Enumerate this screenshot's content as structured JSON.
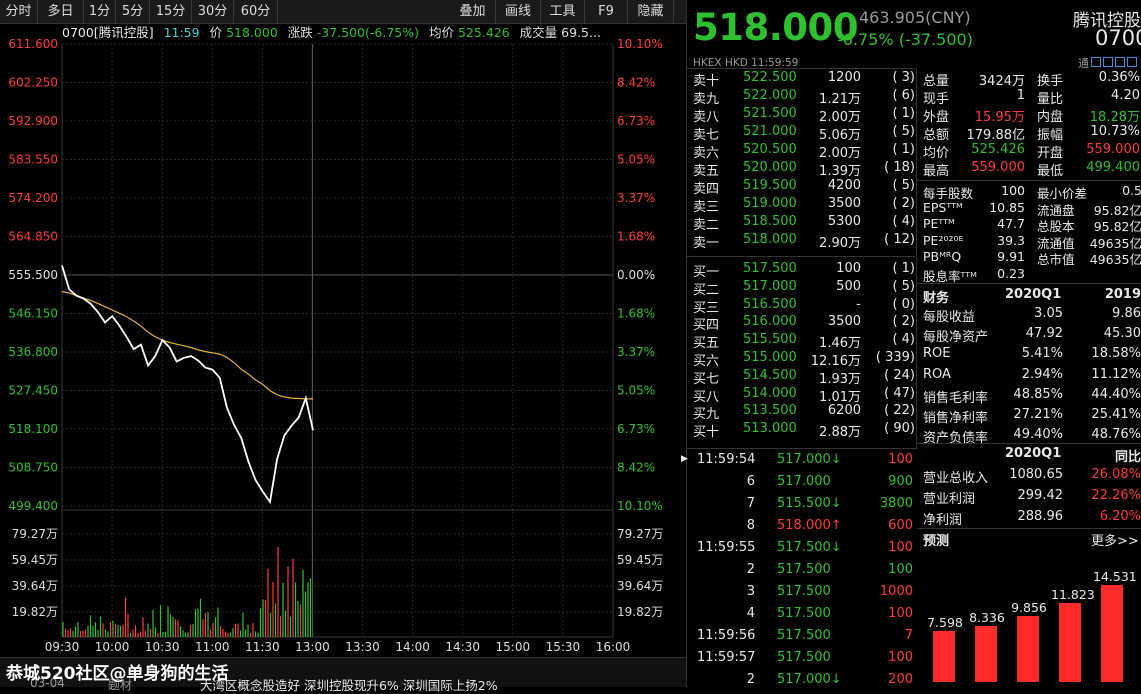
{
  "toolbar": {
    "tabs": [
      "分时",
      "多日",
      "1分",
      "5分",
      "15分",
      "30分",
      "60分"
    ],
    "right": [
      "叠加",
      "画线",
      "工具",
      "F9",
      "隐藏"
    ]
  },
  "info_bar": {
    "code": "0700[腾讯控股]",
    "time": "11:59",
    "price_label": "价",
    "price": "518.000",
    "change_label": "涨跌",
    "change": "-37.500(-6.75%)",
    "avg_label": "均价",
    "avg": "525.426",
    "vol_label": "成交量",
    "vol": "69.5..."
  },
  "price_axis": {
    "left": [
      "611.600",
      "602.250",
      "592.900",
      "583.550",
      "574.200",
      "564.850",
      "555.500",
      "546.150",
      "536.800",
      "527.450",
      "518.100",
      "508.750",
      "499.400"
    ],
    "right": [
      "10.10%",
      "8.42%",
      "6.73%",
      "5.05%",
      "3.37%",
      "1.68%",
      "0.00%",
      "1.68%",
      "3.37%",
      "5.05%",
      "6.73%",
      "8.42%",
      "10.10%"
    ]
  },
  "vol_axis": [
    "79.27万",
    "59.45万",
    "39.64万",
    "19.82万"
  ],
  "time_axis": [
    "09:30",
    "10:00",
    "10:30",
    "11:00",
    "11:30",
    "13:00",
    "13:30",
    "14:00",
    "14:30",
    "15:00",
    "15:30",
    "16:00"
  ],
  "chart_data": {
    "type": "line",
    "series": [
      {
        "values": [
          557.8,
          552,
          550.5,
          549.8,
          548.5,
          546.5,
          544,
          545.5,
          543.2,
          540.5,
          537.5,
          538.6,
          533.5,
          535.8,
          539.7,
          537.9,
          534.5,
          535.4,
          535.8,
          534.7,
          533,
          532.5,
          530.5,
          523.3,
          519.1,
          515.9,
          510.1,
          505.7,
          502.9,
          500.4,
          510.8,
          516.5,
          518.9,
          520.9,
          525.6,
          517.8
        ]
      },
      {
        "values": [
          551.5,
          551.1,
          550.5,
          549.9,
          549.3,
          548.6,
          547.8,
          547,
          546.2,
          545.4,
          544.3,
          543.1,
          541.6,
          540.5,
          539.7,
          539.1,
          538.7,
          538.3,
          537.9,
          537.3,
          536.9,
          536.6,
          536.3,
          535.5,
          534.2,
          532.6,
          531.4,
          530,
          528.9,
          527.4,
          526.4,
          525.9,
          525.6,
          525.5,
          525.4,
          525.4
        ]
      }
    ]
  },
  "watermark": "恭城520社区@单身狗的生活",
  "news": {
    "date": "03-04",
    "cat": "题材",
    "text": "大湾区概念股造好 深圳控股现升6% 深圳国际上扬2%"
  },
  "quote": {
    "price": "518.000",
    "change_pct": "-6.75%",
    "change": "(-37.500)",
    "cny": "463.905(CNY)",
    "name": "腾讯控股",
    "code": "0700",
    "market": "HKEX  HKD  11:59:59",
    "icons": "通"
  },
  "asks": [
    {
      "l": "卖十",
      "p": "522.500",
      "v": "1200",
      "n": "3"
    },
    {
      "l": "卖九",
      "p": "522.000",
      "v": "1.21万",
      "n": "6"
    },
    {
      "l": "卖八",
      "p": "521.500",
      "v": "2.00万",
      "n": "1"
    },
    {
      "l": "卖七",
      "p": "521.000",
      "v": "5.06万",
      "n": "5"
    },
    {
      "l": "卖六",
      "p": "520.500",
      "v": "2.00万",
      "n": "1"
    },
    {
      "l": "卖五",
      "p": "520.000",
      "v": "1.39万",
      "n": "18"
    },
    {
      "l": "卖四",
      "p": "519.500",
      "v": "4200",
      "n": "5"
    },
    {
      "l": "卖三",
      "p": "519.000",
      "v": "3500",
      "n": "2"
    },
    {
      "l": "卖二",
      "p": "518.500",
      "v": "5300",
      "n": "4"
    },
    {
      "l": "卖一",
      "p": "518.000",
      "v": "2.90万",
      "n": "12"
    }
  ],
  "bids": [
    {
      "l": "买一",
      "p": "517.500",
      "v": "100",
      "n": "1"
    },
    {
      "l": "买二",
      "p": "517.000",
      "v": "500",
      "n": "5"
    },
    {
      "l": "买三",
      "p": "516.500",
      "v": "-",
      "n": "0"
    },
    {
      "l": "买四",
      "p": "516.000",
      "v": "3500",
      "n": "2"
    },
    {
      "l": "买五",
      "p": "515.500",
      "v": "1.46万",
      "n": "4"
    },
    {
      "l": "买六",
      "p": "515.000",
      "v": "12.16万",
      "n": "339"
    },
    {
      "l": "买七",
      "p": "514.500",
      "v": "1.93万",
      "n": "24"
    },
    {
      "l": "买八",
      "p": "514.000",
      "v": "1.01万",
      "n": "47"
    },
    {
      "l": "买九",
      "p": "513.500",
      "v": "6200",
      "n": "22"
    },
    {
      "l": "买十",
      "p": "513.000",
      "v": "2.88万",
      "n": "90"
    }
  ],
  "stats": [
    {
      "k": "总量",
      "v": "3424万",
      "k2": "换手",
      "v2": "0.36%"
    },
    {
      "k": "现手",
      "v": "1",
      "k2": "量比",
      "v2": "4.20"
    },
    {
      "k": "外盘",
      "v": "15.95万",
      "k2": "内盘",
      "v2": "18.28万"
    },
    {
      "k": "总额",
      "v": "179.88亿",
      "k2": "振幅",
      "v2": "10.73%"
    },
    {
      "k": "均价",
      "v": "525.426",
      "k2": "开盘",
      "v2": "559.000"
    },
    {
      "k": "最高",
      "v": "559.000",
      "k2": "最低",
      "v2": "499.400"
    }
  ],
  "stats2": [
    {
      "k": "每手股数",
      "v": "100",
      "k2": "最小价差",
      "v2": "0.5"
    },
    {
      "k": "EPSᵀᵀᴹ",
      "v": "10.85",
      "k2": "流通盘",
      "v2": "95.82亿"
    },
    {
      "k": "PEᵀᵀᴹ",
      "v": "47.7",
      "k2": "总股本",
      "v2": "95.82亿"
    },
    {
      "k": "PE²⁰²⁰ᴱ",
      "v": "39.3",
      "k2": "流通值",
      "v2": "49635亿"
    },
    {
      "k": "PBᴹᴿQ",
      "v": "9.91",
      "k2": "总市值",
      "v2": "49635亿"
    },
    {
      "k": "股息率ᵀᵀᴹ",
      "v": "0.23",
      "k2": "",
      "v2": ""
    }
  ],
  "fin": {
    "title": "财务",
    "c1": "2020Q1",
    "c2": "2019",
    "rows": [
      {
        "k": "每股收益",
        "a": "3.05",
        "b": "9.86"
      },
      {
        "k": "每股净资产",
        "a": "47.92",
        "b": "45.30"
      },
      {
        "k": "ROE",
        "a": "5.41%",
        "b": "18.58%"
      },
      {
        "k": "ROA",
        "a": "2.94%",
        "b": "11.12%"
      },
      {
        "k": "销售毛利率",
        "a": "48.85%",
        "b": "44.40%"
      },
      {
        "k": "销售净利率",
        "a": "27.21%",
        "b": "25.41%"
      },
      {
        "k": "资产负债率",
        "a": "49.40%",
        "b": "48.76%"
      }
    ]
  },
  "fin2": {
    "c1": "2020Q1",
    "c2": "同比",
    "rows": [
      {
        "k": "营业总收入",
        "a": "1080.65",
        "b": "26.08%"
      },
      {
        "k": "营业利润",
        "a": "299.42",
        "b": "22.26%"
      },
      {
        "k": "净利润",
        "a": "288.96",
        "b": "6.20%"
      }
    ]
  },
  "forecast": {
    "title": "预测",
    "more": "更多>>",
    "values": [
      "7.598",
      "8.336",
      "9.856",
      "11.823",
      "14.531"
    ]
  },
  "ticks": [
    {
      "t": "11:59:54",
      "p": "517.000",
      "a": "down",
      "v": "100"
    },
    {
      "t": "6",
      "p": "517.000",
      "a": "",
      "v": "900"
    },
    {
      "t": "7",
      "p": "515.500",
      "a": "down",
      "v": "3800"
    },
    {
      "t": "8",
      "p": "518.000",
      "a": "up",
      "v": "600"
    },
    {
      "t": "11:59:55",
      "p": "517.500",
      "a": "down",
      "v": "100"
    },
    {
      "t": "2",
      "p": "517.500",
      "a": "",
      "v": "100"
    },
    {
      "t": "3",
      "p": "517.500",
      "a": "",
      "v": "1000"
    },
    {
      "t": "4",
      "p": "517.500",
      "a": "",
      "v": "100"
    },
    {
      "t": "11:59:56",
      "p": "517.500",
      "a": "",
      "v": "7"
    },
    {
      "t": "11:59:57",
      "p": "517.500",
      "a": "",
      "v": "100"
    },
    {
      "t": "2",
      "p": "517.000",
      "a": "down",
      "v": "200"
    }
  ]
}
